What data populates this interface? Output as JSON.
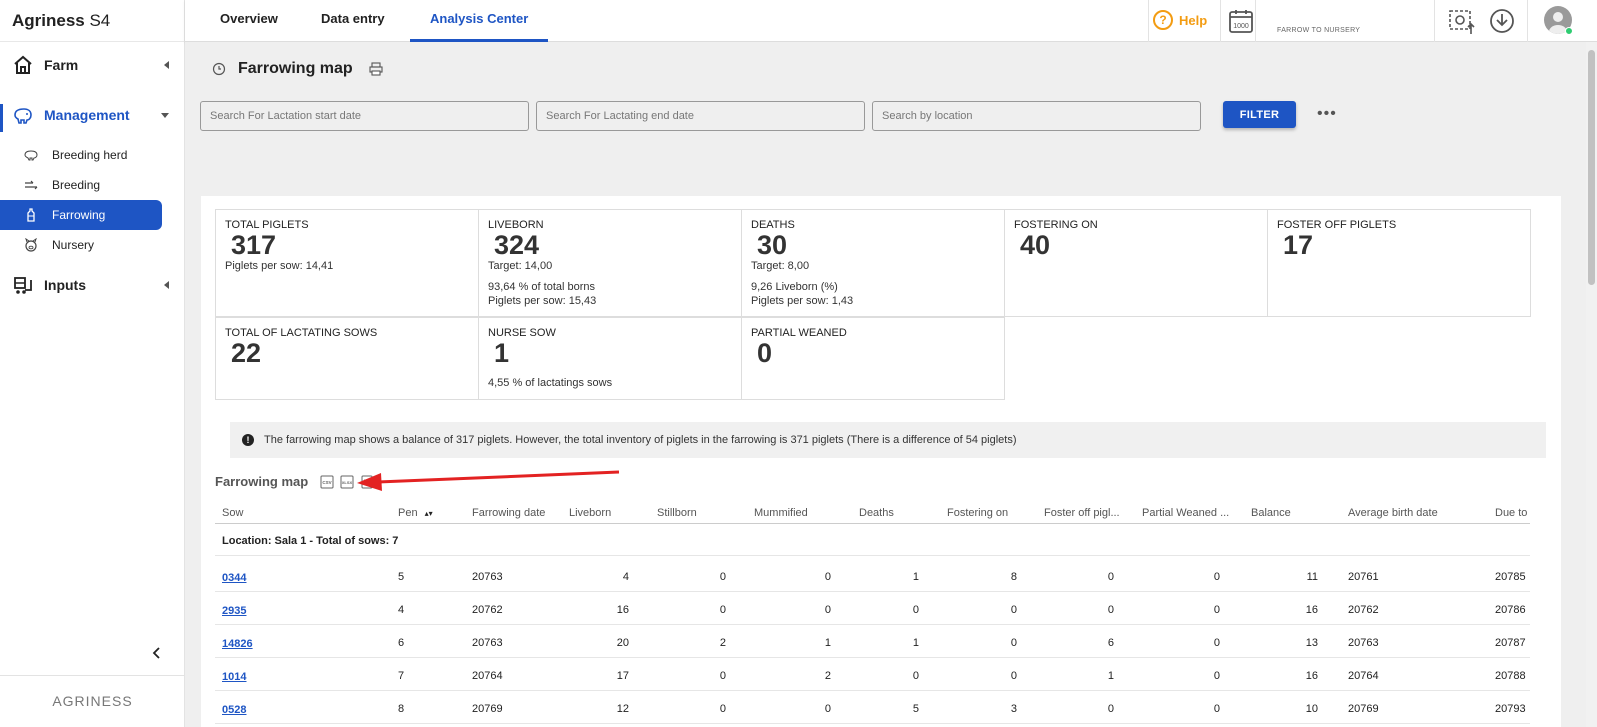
{
  "app": {
    "brand_bold": "Agriness",
    "brand_rest": " S4",
    "footer": "AGRINESS"
  },
  "sidebar": {
    "groups": [
      {
        "label": "Farm",
        "icon": "farm-icon"
      },
      {
        "label": "Management",
        "icon": "pig-icon"
      },
      {
        "label": "Inputs",
        "icon": "inputs-icon"
      }
    ],
    "items": [
      {
        "label": "Breeding herd",
        "icon": "sow-icon"
      },
      {
        "label": "Breeding",
        "icon": "breeding-icon"
      },
      {
        "label": "Farrowing",
        "icon": "bottle-icon"
      },
      {
        "label": "Nursery",
        "icon": "piglet-icon"
      }
    ]
  },
  "topbar": {
    "tabs": [
      "Overview",
      "Data entry",
      "Analysis Center"
    ],
    "active_tab": "Analysis Center",
    "help": "Help",
    "calendar_label": "1000",
    "farm_subtitle": "FARROW TO NURSERY"
  },
  "page": {
    "title": "Farrowing map",
    "search_start_placeholder": "Search For Lactation start date",
    "search_end_placeholder": "Search For Lactating end date",
    "search_location_placeholder": "Search by location",
    "filter_label": "FILTER",
    "more": "•••"
  },
  "cards": {
    "total_piglets": {
      "title": "TOTAL PIGLETS",
      "value": "317",
      "l1": "Piglets per sow:  14,41"
    },
    "liveborn": {
      "title": "LIVEBORN",
      "value": "324",
      "l1": "Target:  14,00",
      "l2": " 93,64 % of total borns",
      "l3": "Piglets per sow:  15,43"
    },
    "deaths": {
      "title": "DEATHS",
      "value": "30",
      "l1": "Target:  8,00",
      "l2": " 9,26 Liveborn (%)",
      "l3": "Piglets per sow:  1,43"
    },
    "fostering_on": {
      "title": "FOSTERING ON",
      "value": "40"
    },
    "foster_off": {
      "title": "FOSTER OFF PIGLETS",
      "value": "17"
    },
    "lactating_sows": {
      "title": "TOTAL OF LACTATING SOWS",
      "value": "22"
    },
    "nurse_sow": {
      "title": "NURSE SOW",
      "value": "1",
      "l1": " 4,55 % of lactatings sows"
    },
    "partial_weaned": {
      "title": "PARTIAL WEANED",
      "value": "0"
    }
  },
  "info": "The farrowing map shows a balance of 317 piglets. However, the total inventory of piglets in the farrowing is 371 piglets (There is a difference of 54 piglets)",
  "map": {
    "title": "Farrowing map",
    "export_csv": "CSV",
    "export_xlsx": "XLSX",
    "columns": [
      "Sow",
      "Pen",
      "Farrowing date",
      "Liveborn",
      "Stillborn",
      "Mummified",
      "Deaths",
      "Fostering on",
      "Foster off pigl...",
      "Partial Weaned ...",
      "Balance",
      "Average birth date",
      "Due to"
    ],
    "group": "Location: Sala 1 - Total of sows: 7",
    "rows": [
      {
        "sow": "0344",
        "pen": "5",
        "farrowing": "20763",
        "liveborn": "4",
        "stillborn": "0",
        "mummified": "0",
        "deaths": "1",
        "fostering_on": "8",
        "foster_off": "0",
        "partial": "0",
        "balance": "11",
        "avg_birth": "20761",
        "due": "20785"
      },
      {
        "sow": "2935",
        "pen": "4",
        "farrowing": "20762",
        "liveborn": "16",
        "stillborn": "0",
        "mummified": "0",
        "deaths": "0",
        "fostering_on": "0",
        "foster_off": "0",
        "partial": "0",
        "balance": "16",
        "avg_birth": "20762",
        "due": "20786"
      },
      {
        "sow": "14826",
        "pen": "6",
        "farrowing": "20763",
        "liveborn": "20",
        "stillborn": "2",
        "mummified": "1",
        "deaths": "1",
        "fostering_on": "0",
        "foster_off": "6",
        "partial": "0",
        "balance": "13",
        "avg_birth": "20763",
        "due": "20787"
      },
      {
        "sow": "1014",
        "pen": "7",
        "farrowing": "20764",
        "liveborn": "17",
        "stillborn": "0",
        "mummified": "2",
        "deaths": "0",
        "fostering_on": "0",
        "foster_off": "1",
        "partial": "0",
        "balance": "16",
        "avg_birth": "20764",
        "due": "20788"
      },
      {
        "sow": "0528",
        "pen": "8",
        "farrowing": "20769",
        "liveborn": "12",
        "stillborn": "0",
        "mummified": "0",
        "deaths": "5",
        "fostering_on": "3",
        "foster_off": "0",
        "partial": "0",
        "balance": "10",
        "avg_birth": "20769",
        "due": "20793"
      }
    ]
  },
  "colors": {
    "accent": "#1e55c4",
    "help": "#f39c12",
    "arrow": "#e32222"
  }
}
